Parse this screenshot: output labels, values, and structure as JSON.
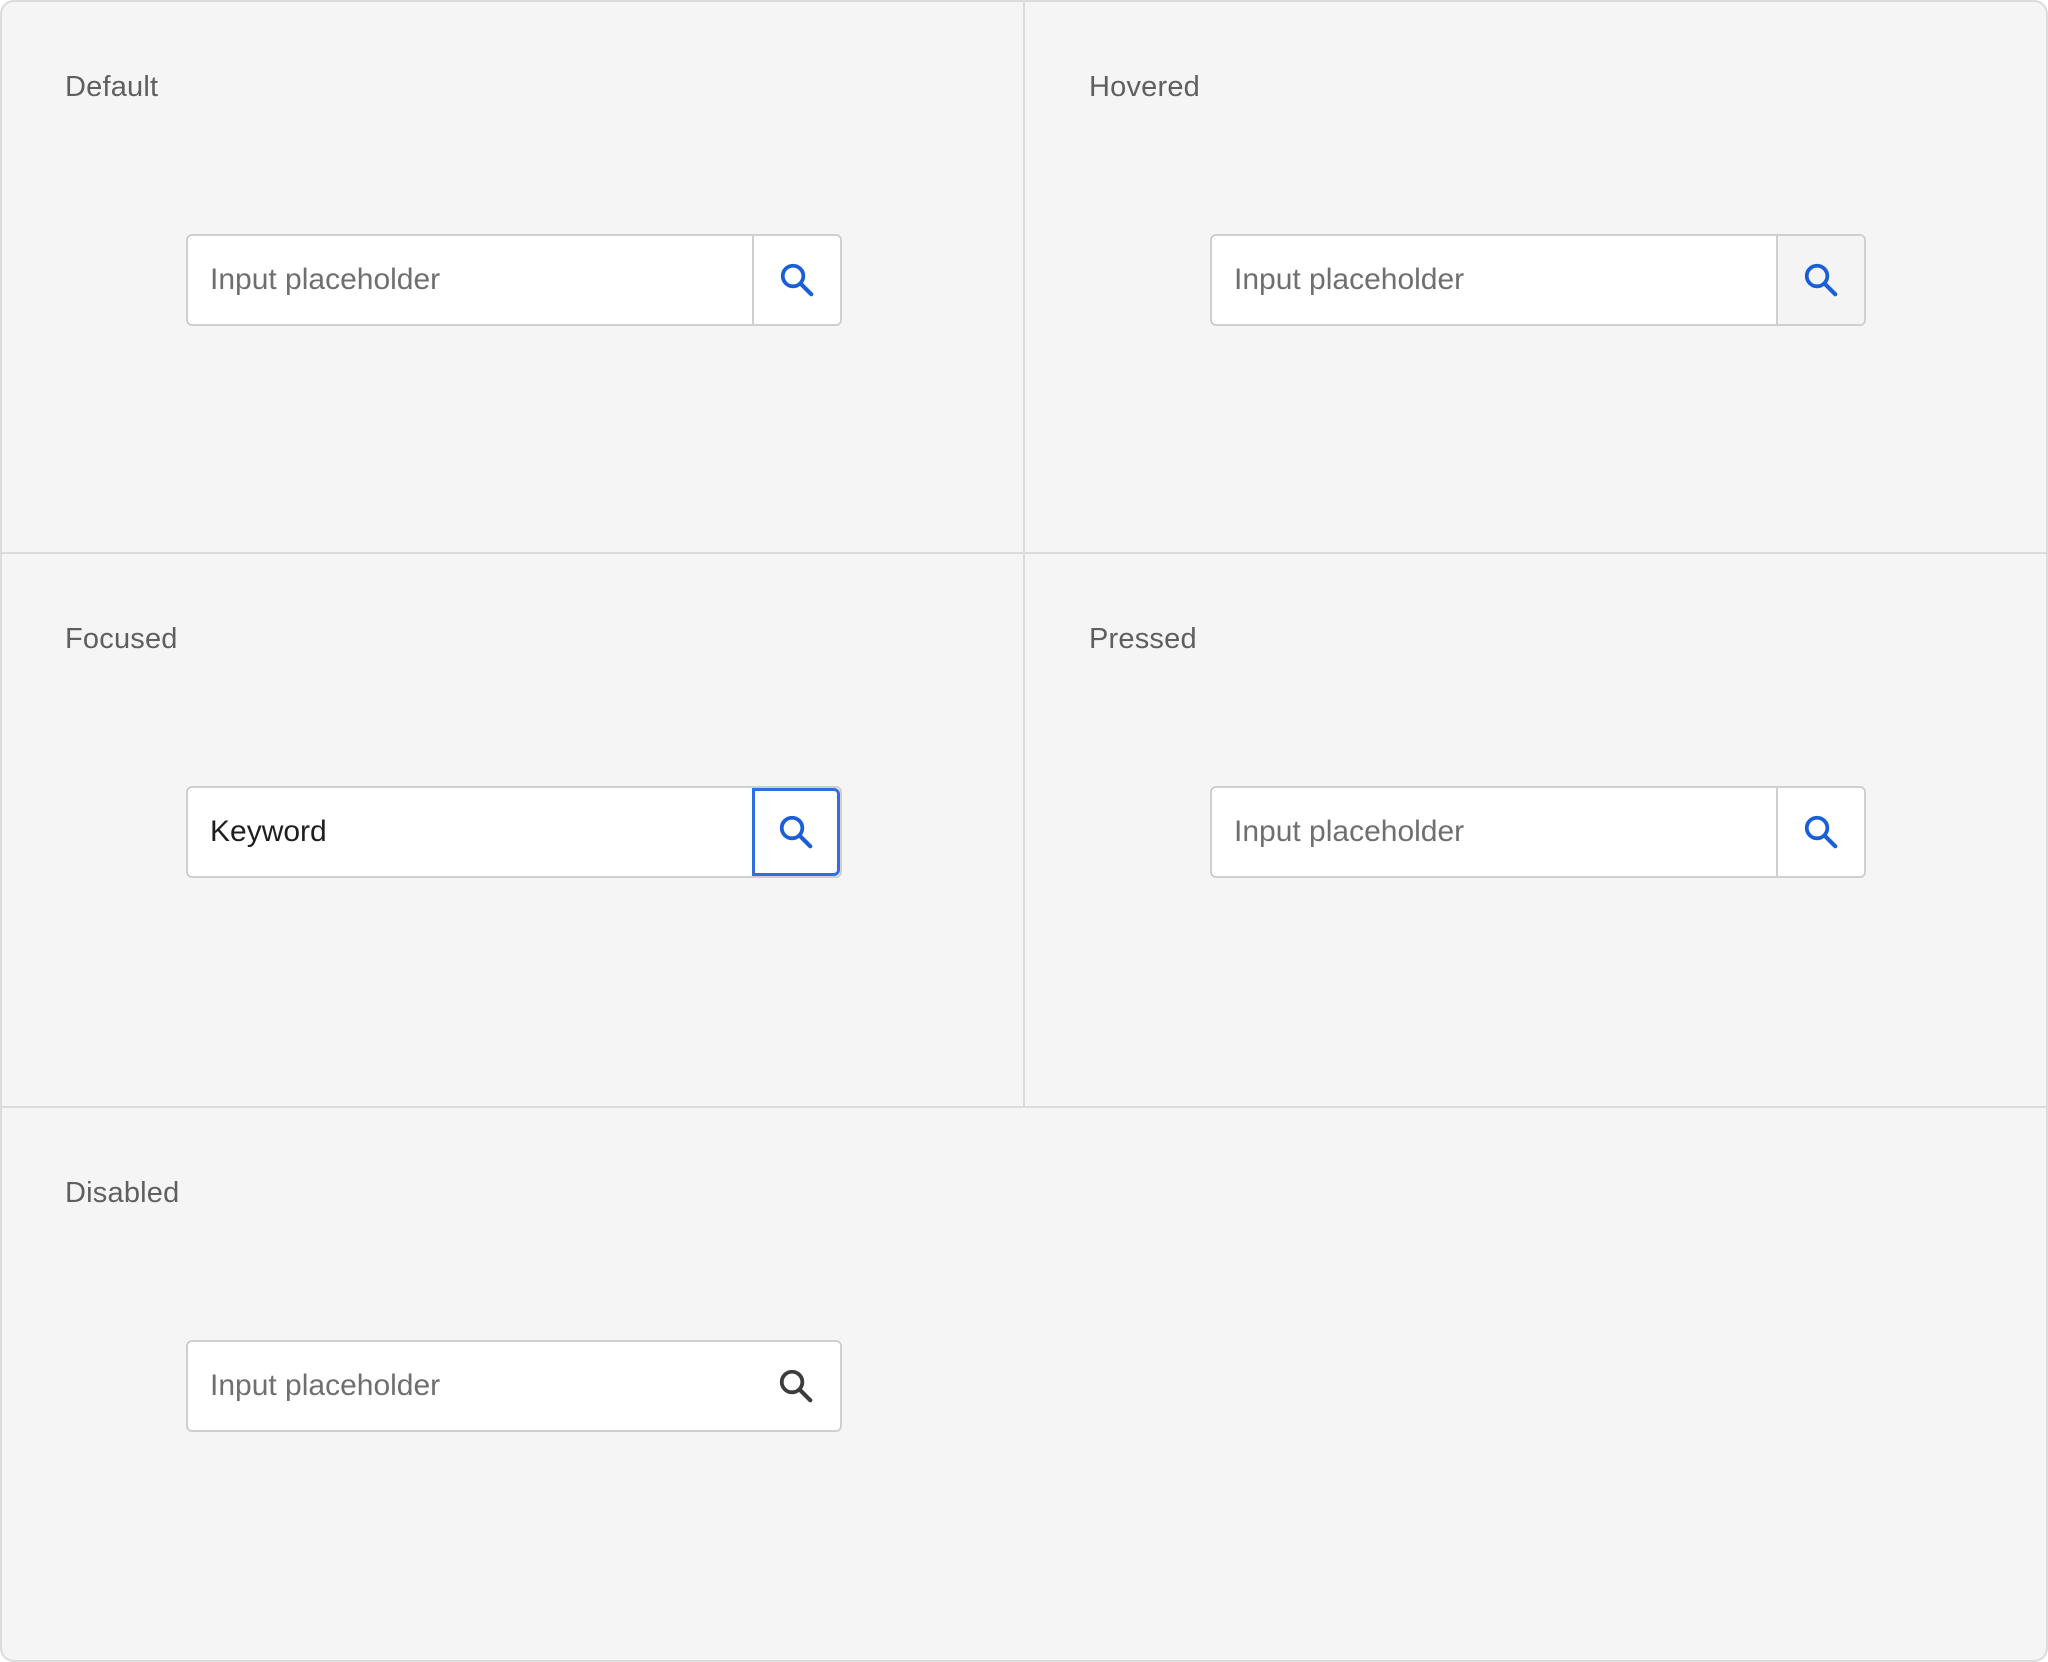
{
  "states": [
    {
      "label": "Default",
      "placeholder": "Input placeholder",
      "value": "",
      "button_state": "default"
    },
    {
      "label": "Hovered",
      "placeholder": "Input placeholder",
      "value": "",
      "button_state": "hovered"
    },
    {
      "label": "Focused",
      "placeholder": "Input placeholder",
      "value": "Keyword",
      "button_state": "focused"
    },
    {
      "label": "Pressed",
      "placeholder": "Input placeholder",
      "value": "",
      "button_state": "pressed"
    },
    {
      "label": "Disabled",
      "placeholder": "Input placeholder",
      "value": "",
      "button_state": "disabled"
    }
  ],
  "icons": {
    "search": "search-icon"
  },
  "colors": {
    "accent": "#1a5fd6",
    "disabled_icon": "#3c3c3c",
    "focus_ring": "#2f6fe0",
    "panel_bg": "#f5f5f5",
    "border": "#cfcfcf"
  }
}
